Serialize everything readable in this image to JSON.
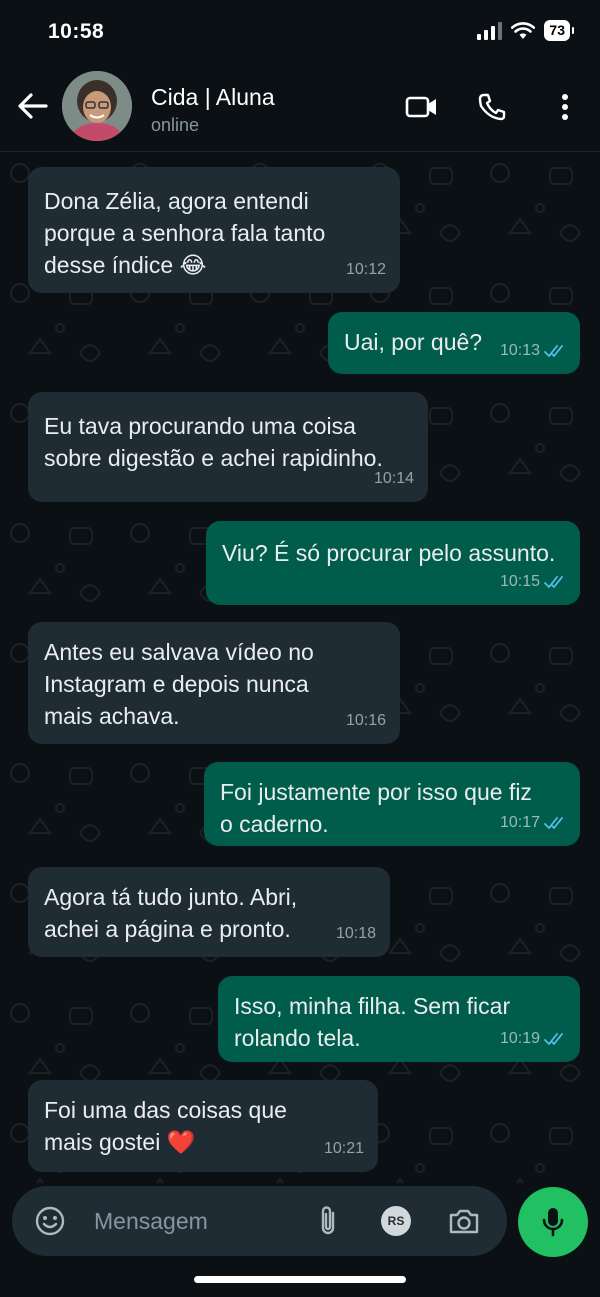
{
  "status_bar": {
    "time": "10:58",
    "battery": "73"
  },
  "header": {
    "contact_name": "Cida | Aluna",
    "contact_status": "online"
  },
  "messages": [
    {
      "direction": "in",
      "text": "Dona Zélia, agora entendi porque a senhora fala tanto desse índice 😂",
      "time": "10:12"
    },
    {
      "direction": "out",
      "text": "Uai, por quê?",
      "time": "10:13",
      "read": true
    },
    {
      "direction": "in",
      "text": "Eu tava procurando uma coisa sobre digestão e achei rapidinho.",
      "time": "10:14"
    },
    {
      "direction": "out",
      "text": "Viu? É só procurar pelo assunto.",
      "time": "10:15",
      "read": true
    },
    {
      "direction": "in",
      "text": "Antes eu salvava vídeo no Instagram e depois nunca mais achava.",
      "time": "10:16"
    },
    {
      "direction": "out",
      "text": "Foi justamente por isso que fiz o caderno.",
      "time": "10:17",
      "read": true
    },
    {
      "direction": "in",
      "text": "Agora tá tudo junto. Abri, achei a página e pronto.",
      "time": "10:18"
    },
    {
      "direction": "out",
      "text": "Isso, minha filha. Sem ficar rolando tela.",
      "time": "10:19",
      "read": true
    },
    {
      "direction": "in",
      "text": "Foi uma das coisas que mais gostei ❤️",
      "time": "10:21"
    }
  ],
  "composer": {
    "placeholder": "Mensagem",
    "badge": "RS"
  },
  "colors": {
    "incoming_bubble": "#202c33",
    "outgoing_bubble": "#005c4b",
    "accent": "#21c063",
    "read_ticks": "#53bdeb"
  },
  "icons": [
    "back-arrow-icon",
    "video-call-icon",
    "phone-icon",
    "more-options-icon",
    "emoji-icon",
    "attach-icon",
    "camera-icon",
    "mic-icon",
    "double-check-icon"
  ]
}
